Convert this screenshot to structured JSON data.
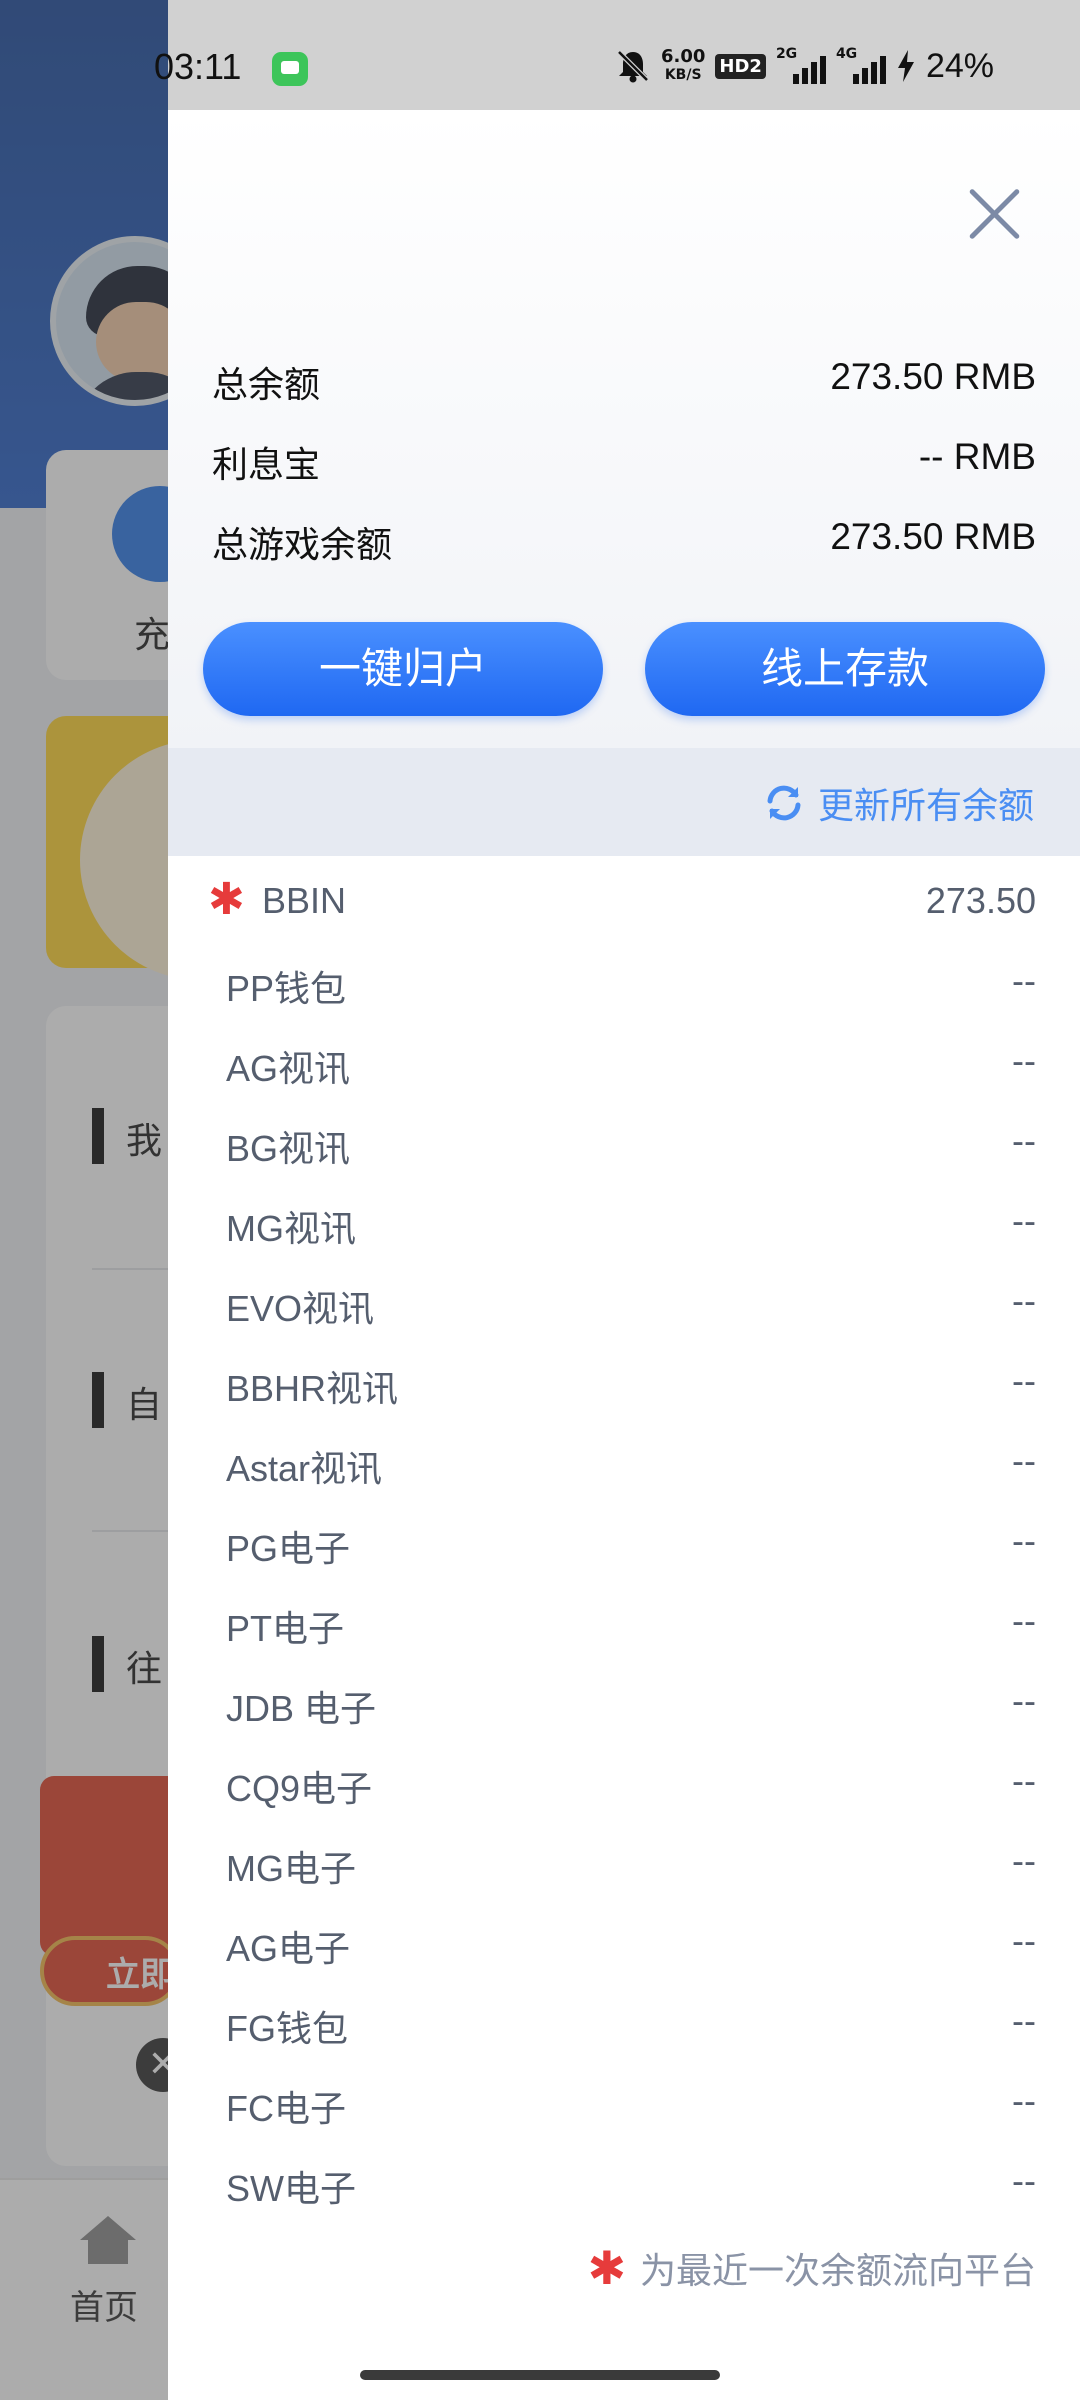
{
  "status_bar": {
    "time": "03:11",
    "net_speed": "6.00",
    "net_unit": "KB/S",
    "hd_badge": "HD2",
    "sim1": "2G",
    "sim2": "4G",
    "battery": "24%"
  },
  "background": {
    "card_label": "充",
    "sections": [
      "我",
      "自",
      "往"
    ],
    "gift_button": "立即",
    "tab_home": "首页"
  },
  "summary": {
    "total_balance_label": "总余额",
    "total_balance_value": "273.50 RMB",
    "interest_label": "利息宝",
    "interest_value": "-- RMB",
    "game_balance_label": "总游戏余额",
    "game_balance_value": "273.50 RMB"
  },
  "actions": {
    "consolidate": "一键归户",
    "deposit": "线上存款"
  },
  "refresh": {
    "label": "更新所有余额"
  },
  "platforms": [
    {
      "name": "BBIN",
      "value": "273.50",
      "recent": true
    },
    {
      "name": "PP钱包",
      "value": "--"
    },
    {
      "name": "AG视讯",
      "value": "--"
    },
    {
      "name": "BG视讯",
      "value": "--"
    },
    {
      "name": "MG视讯",
      "value": "--"
    },
    {
      "name": "EVO视讯",
      "value": "--"
    },
    {
      "name": "BBHR视讯",
      "value": "--"
    },
    {
      "name": "Astar视讯",
      "value": "--"
    },
    {
      "name": "PG电子",
      "value": "--"
    },
    {
      "name": "PT电子",
      "value": "--"
    },
    {
      "name": "JDB 电子",
      "value": "--"
    },
    {
      "name": "CQ9电子",
      "value": "--"
    },
    {
      "name": "MG电子",
      "value": "--"
    },
    {
      "name": "AG电子",
      "value": "--"
    },
    {
      "name": "FG钱包",
      "value": "--"
    },
    {
      "name": "FC电子",
      "value": "--"
    },
    {
      "name": "SW电子",
      "value": "--"
    }
  ],
  "legend": {
    "text": "为最近一次余额流向平台"
  },
  "colors": {
    "accent": "#2b73f6",
    "star": "#e63b3b",
    "refresh": "#4a8ef3"
  }
}
